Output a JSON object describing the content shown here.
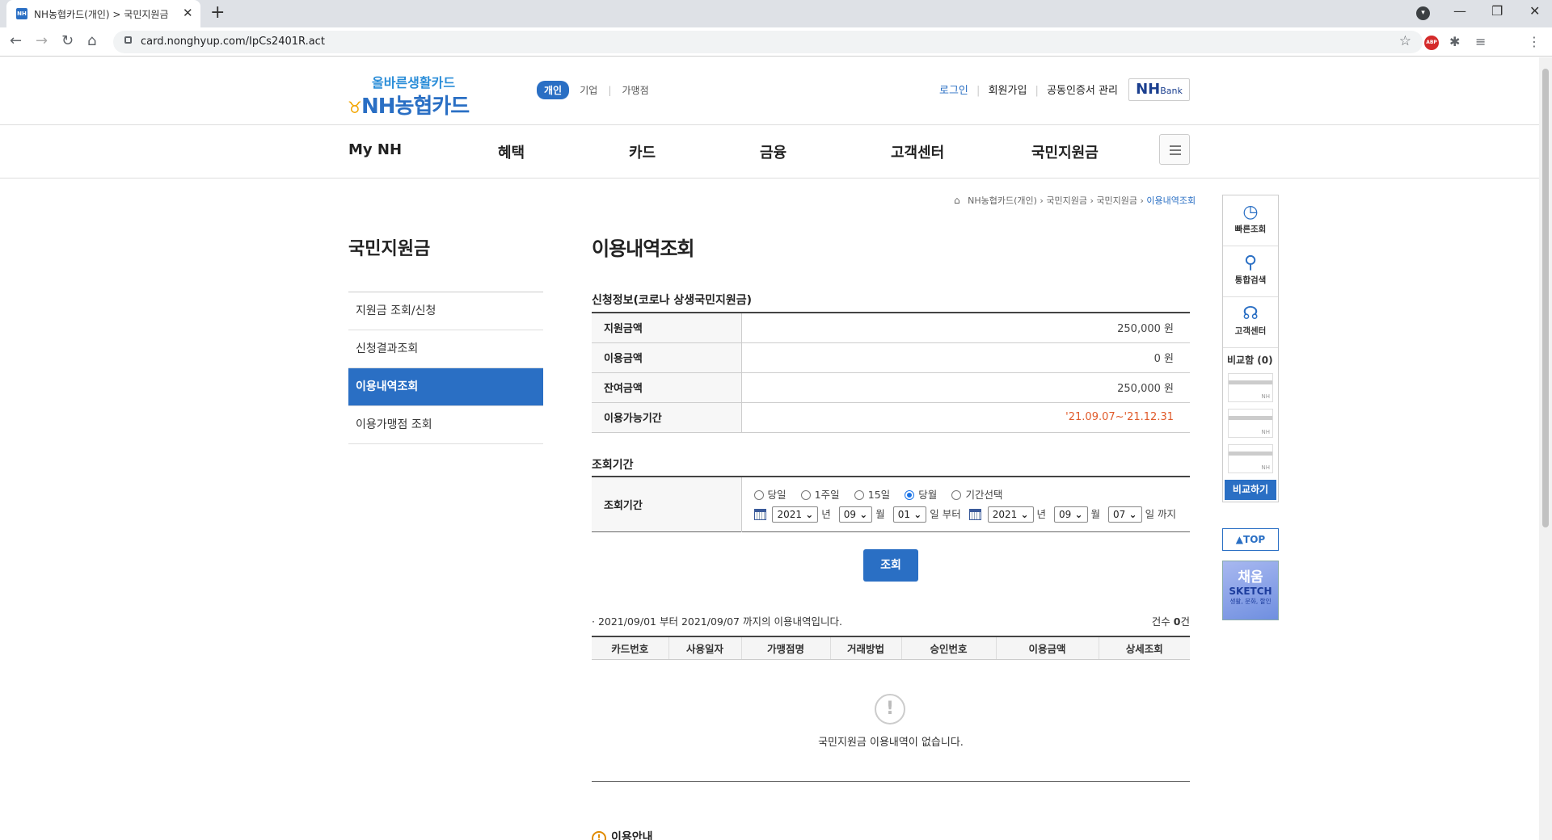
{
  "browser": {
    "tab_title": "NH농협카드(개인) > 국민지원금",
    "favicon_text": "NH",
    "url": "card.nonghyup.com/IpCs2401R.act",
    "ext_abp": "ABP"
  },
  "header": {
    "logo_sub": "올바른생활카드",
    "logo_main": "NH농협카드",
    "user_tabs": [
      "개인",
      "기업",
      "가맹점"
    ],
    "links": {
      "login": "로그인",
      "signup": "회원가입",
      "cert": "공동인증서 관리"
    },
    "nhbank": {
      "main": "NH",
      "sub": "Bank"
    }
  },
  "gnb": [
    "My NH",
    "혜택",
    "카드",
    "금융",
    "고객센터",
    "국민지원금"
  ],
  "breadcrumb": {
    "items": [
      "NH농협카드(개인)",
      "국민지원금",
      "국민지원금"
    ],
    "current": "이용내역조회"
  },
  "sidebar": {
    "title": "국민지원금",
    "items": [
      {
        "label": "지원금 조회/신청",
        "active": false
      },
      {
        "label": "신청결과조회",
        "active": false
      },
      {
        "label": "이용내역조회",
        "active": true
      },
      {
        "label": "이용가맹점 조회",
        "active": false
      }
    ]
  },
  "main": {
    "title": "이용내역조회",
    "info_title": "신청정보(코로나 상생국민지원금)",
    "info_rows": [
      {
        "label": "지원금액",
        "value": "250,000 원"
      },
      {
        "label": "이용금액",
        "value": "0 원"
      },
      {
        "label": "잔여금액",
        "value": "250,000 원"
      },
      {
        "label": "이용가능기간",
        "value": "'21.09.07~'21.12.31"
      }
    ],
    "period_title": "조회기간",
    "period_label": "조회기간",
    "period_options": [
      "당일",
      "1주일",
      "15일",
      "당월",
      "기간선택"
    ],
    "period_selected": "당월",
    "from": {
      "year": "2021",
      "month": "09",
      "day": "01"
    },
    "to": {
      "year": "2021",
      "month": "09",
      "day": "07"
    },
    "date_units": {
      "year": "년",
      "month": "월",
      "from_suffix": "일 부터",
      "to_suffix": "일 까지"
    },
    "search_button": "조회",
    "result_summary": "2021/09/01 부터 2021/09/07 까지의 이용내역입니다.",
    "count_label": "건수",
    "count_value": "0",
    "count_unit": "건",
    "columns": [
      "카드번호",
      "사용일자",
      "가맹점명",
      "거래방법",
      "승인번호",
      "이용금액",
      "상세조회"
    ],
    "empty_message": "국민지원금 이용내역이 없습니다.",
    "guide_title": "이용안내"
  },
  "quick_menu": {
    "items": [
      {
        "label": "빠른조회",
        "icon": "clock-icon"
      },
      {
        "label": "통합검색",
        "icon": "search-icon"
      },
      {
        "label": "고객센터",
        "icon": "headset-icon"
      }
    ],
    "compare_title": "비교함 (0)",
    "compare_slot_text": "NH",
    "compare_button": "비교하기",
    "top_button": "TOP"
  },
  "banner": {
    "line1": "채움",
    "line2": "SKETCH",
    "line3": "생활, 문화, 할인"
  },
  "colors": {
    "primary": "#2a6fc4",
    "period_value": "#e05a2a"
  }
}
